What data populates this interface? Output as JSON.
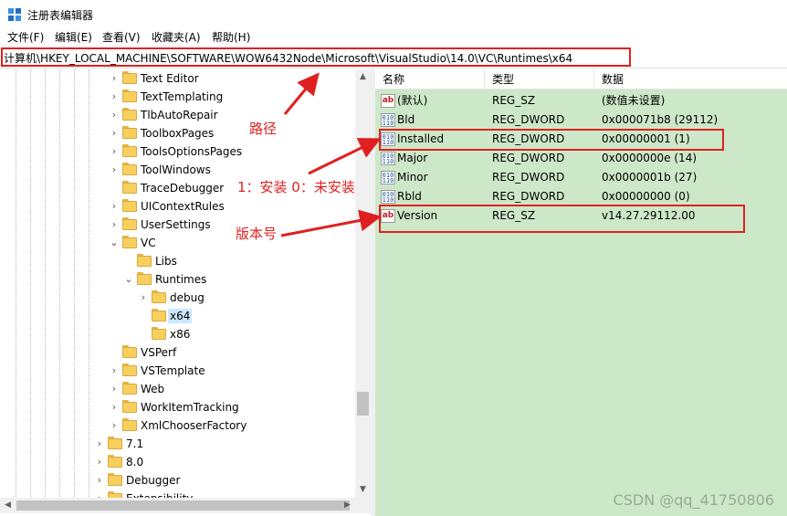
{
  "window": {
    "title": "注册表编辑器",
    "icon": "regedit-icon"
  },
  "menu": [
    "文件(F)",
    "编辑(E)",
    "查看(V)",
    "收藏夹(A)",
    "帮助(H)"
  ],
  "address": "计算机\\HKEY_LOCAL_MACHINE\\SOFTWARE\\WOW6432Node\\Microsoft\\VisualStudio\\14.0\\VC\\Runtimes\\x64",
  "tree": {
    "items": [
      {
        "label": "Text Editor",
        "expander": ">"
      },
      {
        "label": "TextTemplating",
        "expander": ">"
      },
      {
        "label": "TlbAutoRepair",
        "expander": ">"
      },
      {
        "label": "ToolboxPages",
        "expander": ">"
      },
      {
        "label": "ToolsOptionsPages",
        "expander": ">"
      },
      {
        "label": "ToolWindows",
        "expander": ">"
      },
      {
        "label": "TraceDebugger",
        "expander": ""
      },
      {
        "label": "UIContextRules",
        "expander": ">"
      },
      {
        "label": "UserSettings",
        "expander": ">"
      },
      {
        "label": "VC",
        "expander": "v"
      },
      {
        "label": "Libs",
        "expander": ""
      },
      {
        "label": "Runtimes",
        "expander": "v"
      },
      {
        "label": "debug",
        "expander": ">"
      },
      {
        "label": "x64",
        "expander": "",
        "selected": true
      },
      {
        "label": "x86",
        "expander": ""
      },
      {
        "label": "VSPerf",
        "expander": ""
      },
      {
        "label": "VSTemplate",
        "expander": ">"
      },
      {
        "label": "Web",
        "expander": ">"
      },
      {
        "label": "WorkItemTracking",
        "expander": ">"
      },
      {
        "label": "XmlChooserFactory",
        "expander": ">"
      },
      {
        "label": "7.1",
        "expander": ">"
      },
      {
        "label": "8.0",
        "expander": ">"
      },
      {
        "label": "Debugger",
        "expander": ">"
      },
      {
        "label": "Extensibility",
        "expander": ">"
      }
    ]
  },
  "values": {
    "headers": {
      "name": "名称",
      "type": "类型",
      "data": "数据"
    },
    "rows": [
      {
        "name": "(默认)",
        "type": "REG_SZ",
        "data": "(数值未设置)",
        "icon": "string-value-icon"
      },
      {
        "name": "Bld",
        "type": "REG_DWORD",
        "data": "0x000071b8 (29112)",
        "icon": "dword-value-icon"
      },
      {
        "name": "Installed",
        "type": "REG_DWORD",
        "data": "0x00000001 (1)",
        "icon": "dword-value-icon"
      },
      {
        "name": "Major",
        "type": "REG_DWORD",
        "data": "0x0000000e (14)",
        "icon": "dword-value-icon"
      },
      {
        "name": "Minor",
        "type": "REG_DWORD",
        "data": "0x0000001b (27)",
        "icon": "dword-value-icon"
      },
      {
        "name": "Rbld",
        "type": "REG_DWORD",
        "data": "0x00000000 (0)",
        "icon": "dword-value-icon"
      },
      {
        "name": "Version",
        "type": "REG_SZ",
        "data": "v14.27.29112.00",
        "icon": "string-value-icon"
      }
    ]
  },
  "annotations": {
    "path": "路径",
    "installed": "1：安装 0：未安装",
    "version": "版本号",
    "color": "#e02020"
  },
  "watermark": "CSDN @qq_41750806"
}
